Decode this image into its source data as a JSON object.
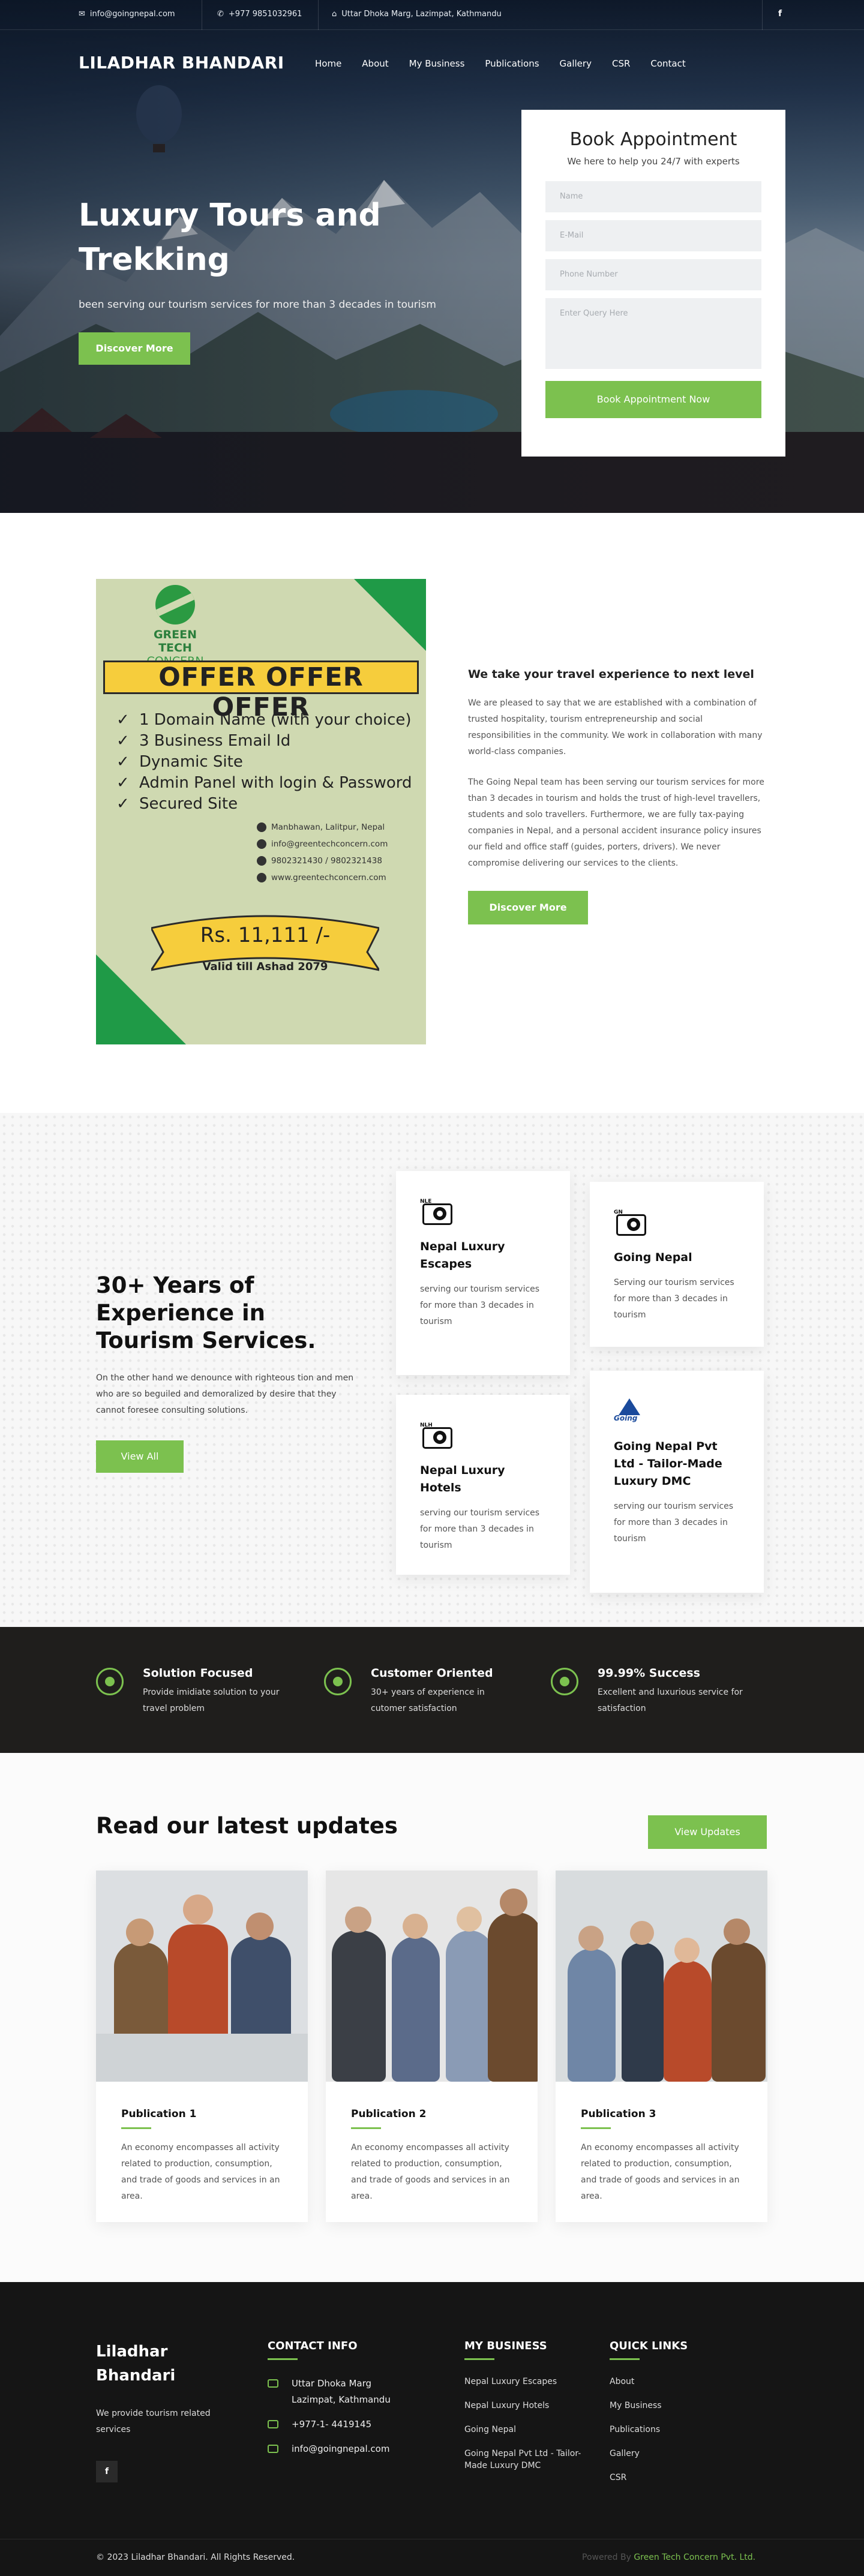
{
  "topbar": {
    "email": "info@goingnepal.com",
    "phone": "+977 9851032961",
    "address": "Uttar Dhoka Marg, Lazimpat, Kathmandu",
    "social": "f"
  },
  "nav": {
    "brand": "LILADHAR BHANDARI",
    "items": [
      "Home",
      "About",
      "My Business",
      "Publications",
      "Gallery",
      "CSR",
      "Contact"
    ]
  },
  "hero": {
    "title": "Luxury Tours and Trekking",
    "subtitle": "been serving our tourism services for more than 3 decades in tourism",
    "cta": "Discover More"
  },
  "booking": {
    "title": "Book Appointment",
    "subtitle": "We here to help you 24/7 with experts",
    "name_placeholder": "Name",
    "email_placeholder": "E-Mail",
    "phone_placeholder": "Phone Number",
    "query_placeholder": "Enter Query Here",
    "submit": "Book Appointment Now"
  },
  "offer": {
    "brand_line1": "GREEN TECH",
    "brand_line2": "CONCERN",
    "banner": "OFFER OFFER OFFER",
    "features": [
      "1 Domain Name (with your choice)",
      "3 Business Email Id",
      "Dynamic Site",
      "Admin Panel with login & Password",
      "Secured Site"
    ],
    "address": "Manbhawan, Lalitpur, Nepal",
    "email": "info@greentechconcern.com",
    "phones": "9802321430 / 9802321438",
    "website": "www.greentechconcern.com",
    "price": "Rs. 11,111 /-",
    "valid": "Valid till Ashad 2079"
  },
  "about": {
    "heading": "We take your travel experience to next level",
    "para1": "We are pleased to say that we are established with a combination of trusted hospitality, tourism entrepreneurship and social responsibilities in the community. We work in collaboration with many world-class companies.",
    "para2": "The Going Nepal team has been serving our tourism services for more than 3 decades in tourism and holds the trust of high-level travellers, students and solo travellers. Furthermore, we are fully tax-paying companies in Nepal, and a personal accident insurance policy insures our field and office staff (guides, porters, drivers). We never compromise delivering our services to the clients.",
    "cta": "Discover More"
  },
  "experience": {
    "heading": "30+ Years of Experience in Tourism Services.",
    "para": "On the other hand we denounce with righteous tion and men who are so beguiled and demoralized by desire that they cannot foresee consulting solutions.",
    "cta": "View All",
    "cards": [
      {
        "title": "Nepal Luxury Escapes",
        "text": "serving our tourism services for more than 3 decades in tourism",
        "icon": "camera-icon"
      },
      {
        "title": "Going Nepal",
        "text": "Serving our tourism services for more than 3 decades in tourism",
        "icon": "camera-icon"
      },
      {
        "title": "Nepal Luxury Hotels",
        "text": "serving our tourism services for more than 3 decades in tourism",
        "icon": "camera-icon"
      },
      {
        "title": "Going Nepal Pvt Ltd - Tailor-Made Luxury DMC",
        "text": "serving our tourism services for more than 3 decades in tourism",
        "icon": "going-nepal-logo"
      }
    ]
  },
  "features": [
    {
      "title": "Solution Focused",
      "text": "Provide imidiate solution to your travel problem"
    },
    {
      "title": "Customer Oriented",
      "text": "30+ years of experience in cutomer satisfaction"
    },
    {
      "title": "99.99% Success",
      "text": "Excellent and luxurious service for satisfaction"
    }
  ],
  "updates": {
    "heading": "Read our latest updates",
    "cta": "View Updates",
    "posts": [
      {
        "title": "Publication 1",
        "text": "An economy encompasses all activity related to production, consumption, and trade of goods and services in an area."
      },
      {
        "title": "Publication 2",
        "text": "An economy encompasses all activity related to production, consumption, and trade of goods and services in an area."
      },
      {
        "title": "Publication 3",
        "text": "An economy encompasses all activity related to production, consumption, and trade of goods and services in an area."
      }
    ]
  },
  "footer": {
    "brand": "Liladhar Bhandari",
    "tagline": "We provide tourism related services",
    "social": "f",
    "contact_title": "CONTACT INFO",
    "contact_address": "Uttar Dhoka Marg Lazimpat, Kathmandu",
    "contact_phone": "+977-1- 4419145",
    "contact_email": "info@goingnepal.com",
    "business_title": "MY BUSINESS",
    "business": [
      "Nepal Luxury Escapes",
      "Nepal Luxury Hotels",
      "Going Nepal",
      "Going Nepal Pvt Ltd - Tailor-Made Luxury DMC"
    ],
    "links_title": "QUICK LINKS",
    "links": [
      "About",
      "My Business",
      "Publications",
      "Gallery",
      "CSR"
    ],
    "copyright": "© 2023 Liladhar Bhandari. All Rights Reserved.",
    "powered_prefix": "Powered By",
    "powered_by": "Green Tech Concern Pvt. Ltd."
  },
  "colors": {
    "accent": "#7cc14f",
    "dark": "#1f1e1c",
    "footer": "#151515"
  }
}
